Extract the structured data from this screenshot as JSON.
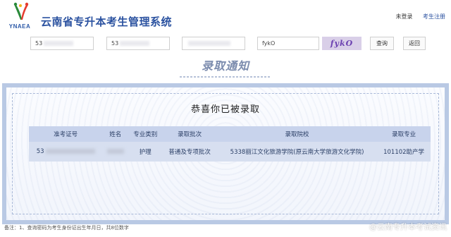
{
  "header": {
    "logo_text": "YNAEA",
    "title": "云南省专升本考生管理系统",
    "not_logged_in": "未登录",
    "register": "考生注册"
  },
  "search": {
    "field1_prefix": "53",
    "field2_prefix": "53",
    "field4_value": "fykO",
    "captcha": "fykO",
    "query_button": "查询",
    "back_button": "返回"
  },
  "banner": {
    "text": "录取通知"
  },
  "certificate": {
    "heading": "恭喜你已被录取",
    "columns": [
      "准考证号",
      "姓名",
      "专业类别",
      "录取批次",
      "录取院校",
      "录取专业"
    ],
    "row": {
      "exam_no_prefix": "53",
      "category": "护理",
      "batch": "普通及专项批次",
      "school": "5338丽江文化旅游学院(原云南大学旅游文化学院)",
      "major": "101102助产学"
    }
  },
  "footer": {
    "note": "备注：1、查询密码为考生身份证出生年月日，共8位数字",
    "watermark": "@云南专升本考试资讯"
  }
}
